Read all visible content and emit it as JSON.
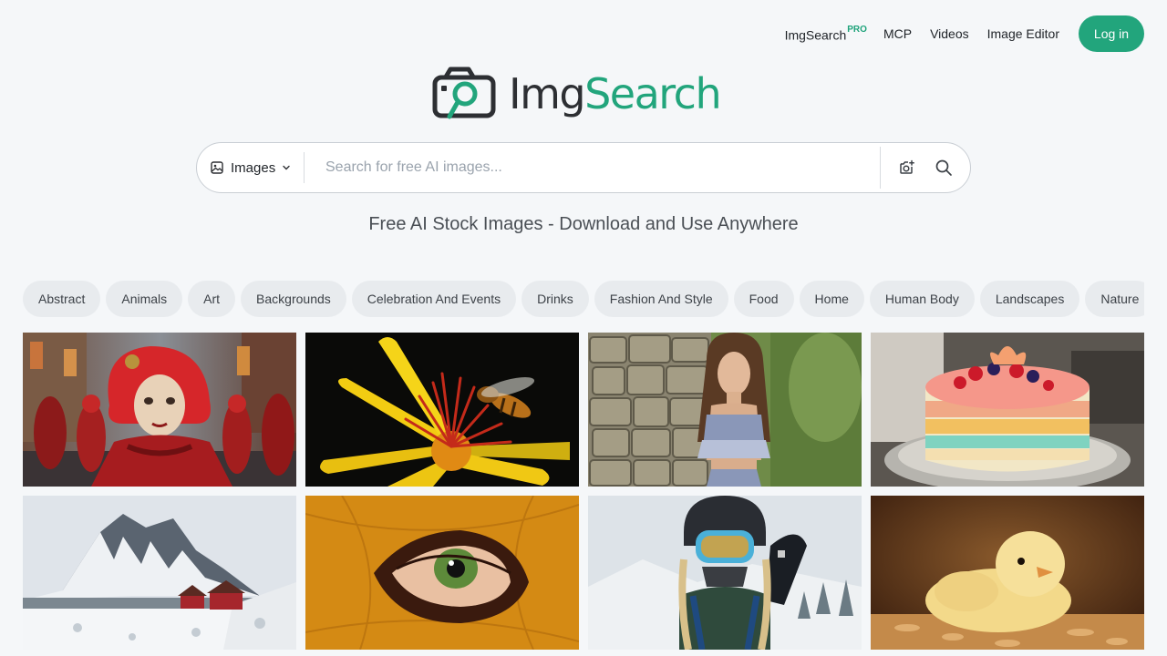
{
  "nav": {
    "pro_label": "ImgSearch",
    "pro_badge": "PRO",
    "links": [
      "MCP",
      "Videos",
      "Image Editor"
    ],
    "login_label": "Log in"
  },
  "logo": {
    "part1": "Img",
    "part2": "Search"
  },
  "search": {
    "type_label": "Images",
    "placeholder": "Search for free AI images...",
    "value": ""
  },
  "tagline": "Free AI Stock Images - Download and Use Anywhere",
  "categories": [
    "Abstract",
    "Animals",
    "Art",
    "Backgrounds",
    "Celebration And Events",
    "Drinks",
    "Fashion And Style",
    "Food",
    "Home",
    "Human Body",
    "Landscapes",
    "Nature"
  ],
  "colors": {
    "accent": "#22a57c",
    "background": "#f5f7f9"
  },
  "tiles": [
    {
      "name": "carnival-mask-woman-image"
    },
    {
      "name": "bee-on-yellow-flower-image"
    },
    {
      "name": "woman-by-stone-wall-image"
    },
    {
      "name": "layered-cake-image"
    },
    {
      "name": "snowy-mountain-cabins-image"
    },
    {
      "name": "eye-through-leaf-image"
    },
    {
      "name": "snowboarder-goggles-image"
    },
    {
      "name": "yellow-chick-image"
    }
  ]
}
